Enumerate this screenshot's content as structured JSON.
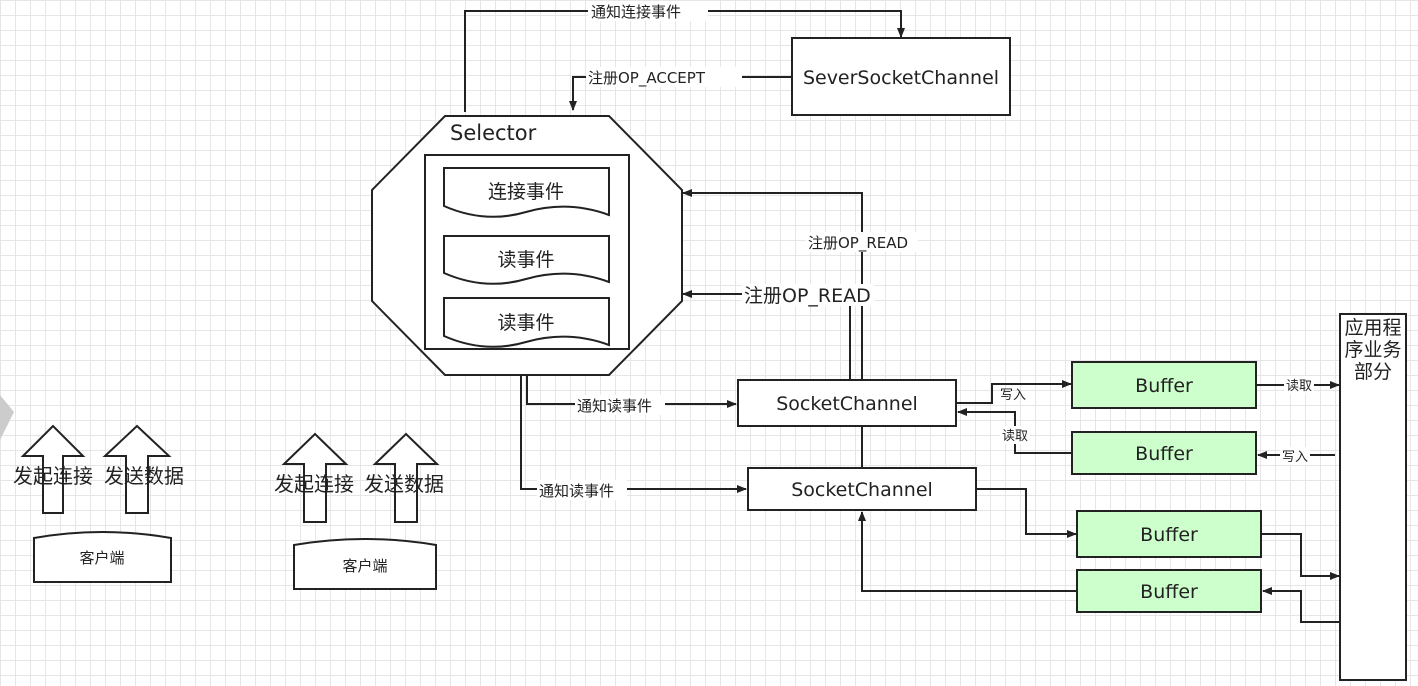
{
  "labels": {
    "notify_connect_event": "通知连接事件",
    "register_op_accept": "注册OP_ACCEPT",
    "server_socket_channel": "SeverSocketChannel",
    "selector": "Selector",
    "connect_event": "连接事件",
    "read_event_1": "读事件",
    "read_event_2": "读事件",
    "register_op_read_top": "注册OP_READ",
    "register_op_read_mid": "注册OP_READ",
    "notify_read_event_1": "通知读事件",
    "notify_read_event_2": "通知读事件",
    "socket_channel_1": "SocketChannel",
    "socket_channel_2": "SocketChannel",
    "write_in_1": "写入",
    "read_out_1": "读取",
    "read_out_2": "读取",
    "write_in_2": "写入",
    "buffer_1": "Buffer",
    "buffer_2": "Buffer",
    "buffer_3": "Buffer",
    "buffer_4": "Buffer",
    "app_business_line1": "应用程",
    "app_business_line2": "序业务",
    "app_business_line3": "部分",
    "client1_initiate_connect": "发起连接",
    "client1_send_data": "发送数据",
    "client2_initiate_connect": "发起连接",
    "client2_send_data": "发送数据",
    "client_1": "客户端",
    "client_2": "客户端"
  },
  "colors": {
    "buffer_fill": "#ccffcc",
    "stroke": "#222222",
    "grid": "#e6e6e6"
  }
}
